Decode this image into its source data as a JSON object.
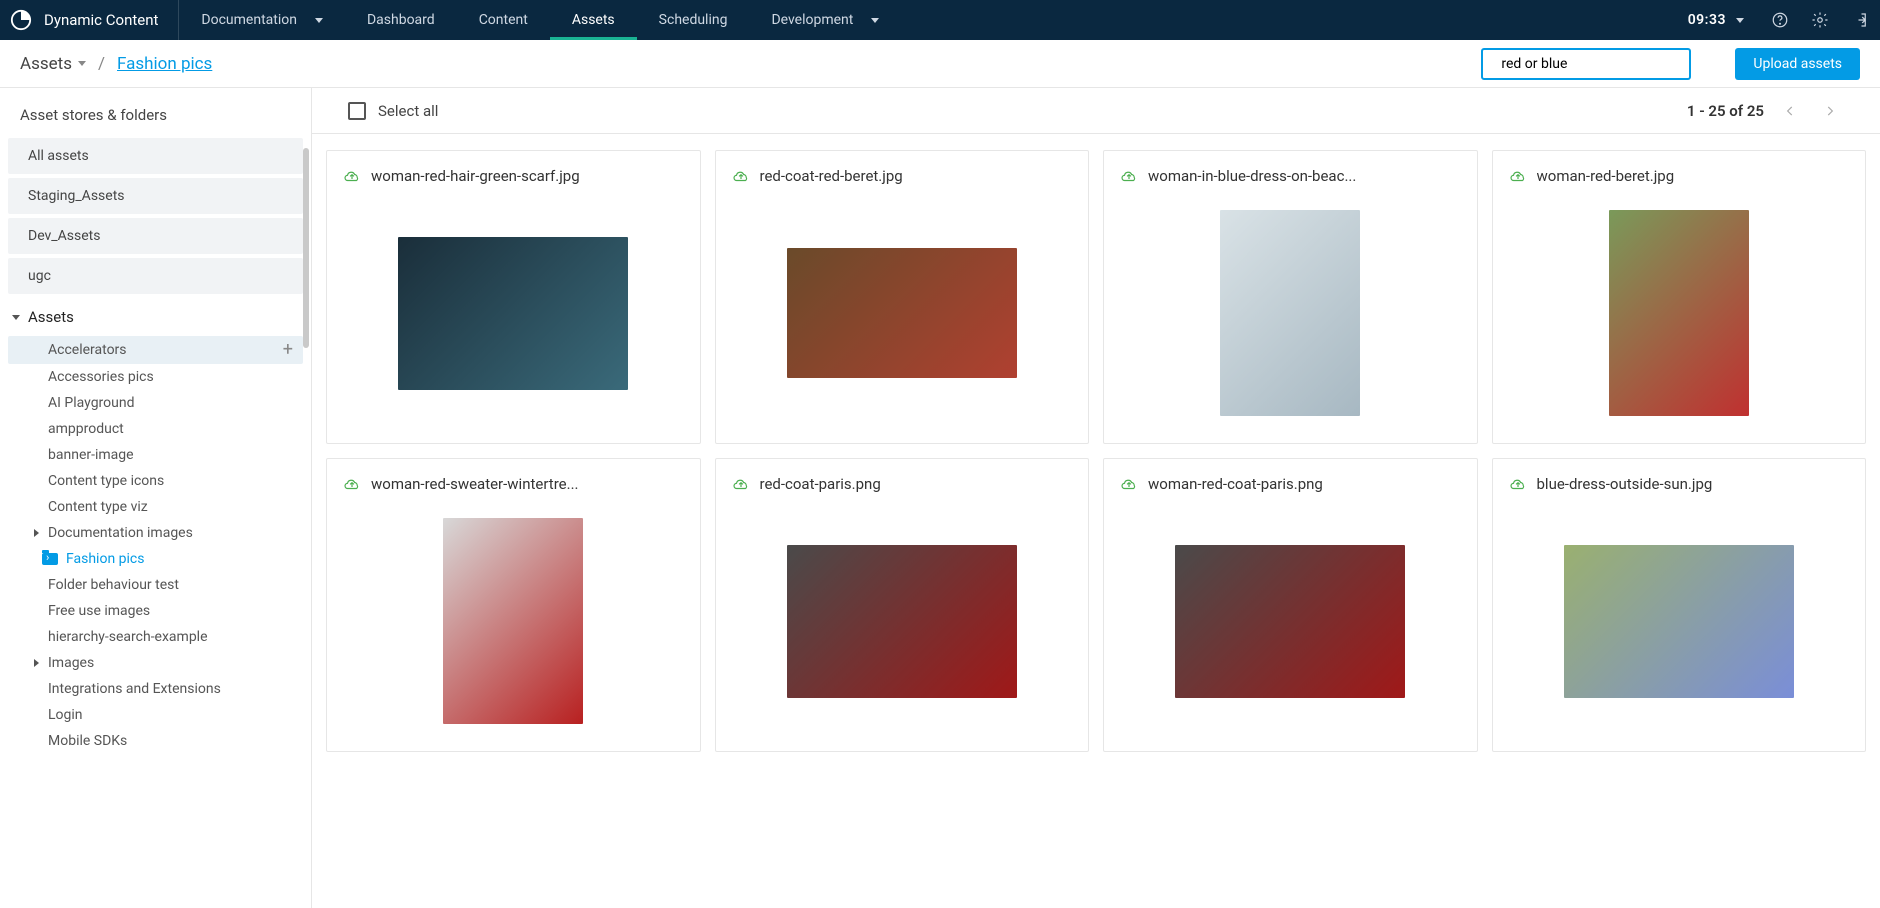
{
  "header": {
    "brand": "Dynamic Content",
    "nav": [
      {
        "label": "Documentation",
        "caret": true
      },
      {
        "label": "Dashboard"
      },
      {
        "label": "Content"
      },
      {
        "label": "Assets",
        "active": true
      },
      {
        "label": "Scheduling"
      },
      {
        "label": "Development",
        "caret": true
      }
    ],
    "time": "09:33"
  },
  "subbar": {
    "root": "Assets",
    "current": "Fashion pics",
    "search_value": "red or blue",
    "upload_label": "Upload assets"
  },
  "sidebar": {
    "heading": "Asset stores & folders",
    "stores": [
      "All assets",
      "Staging_Assets",
      "Dev_Assets",
      "ugc"
    ],
    "assets_root": "Assets",
    "tree": [
      {
        "label": "Accelerators",
        "selected": true,
        "add": true
      },
      {
        "label": "Accessories pics"
      },
      {
        "label": "AI Playground"
      },
      {
        "label": "ampproduct"
      },
      {
        "label": "banner-image"
      },
      {
        "label": "Content type icons"
      },
      {
        "label": "Content type viz"
      },
      {
        "label": "Documentation images",
        "caret": true
      },
      {
        "label": "Fashion pics",
        "highlight": true,
        "icon": true
      },
      {
        "label": "Folder behaviour test"
      },
      {
        "label": "Free use images"
      },
      {
        "label": "hierarchy-search-example"
      },
      {
        "label": "Images",
        "caret": true
      },
      {
        "label": "Integrations and Extensions"
      },
      {
        "label": "Login"
      },
      {
        "label": "Mobile SDKs"
      }
    ]
  },
  "toolbar": {
    "select_all": "Select all",
    "paging": "1 - 25 of 25"
  },
  "assets": [
    {
      "name": "woman-red-hair-green-scarf.jpg",
      "shape": "landscape",
      "g": [
        "#1a2e3a",
        "#3a6a7a"
      ]
    },
    {
      "name": "red-coat-red-beret.jpg",
      "shape": "landscape2",
      "g": [
        "#6a4a2a",
        "#b04030"
      ]
    },
    {
      "name": "woman-in-blue-dress-on-beac...",
      "shape": "portrait",
      "g": [
        "#d9e2e6",
        "#a7b8c2"
      ]
    },
    {
      "name": "woman-red-beret.jpg",
      "shape": "portrait",
      "g": [
        "#7a9a5a",
        "#c03030"
      ]
    },
    {
      "name": "woman-red-sweater-wintertre...",
      "shape": "portrait2",
      "g": [
        "#d8d8d8",
        "#b82020"
      ]
    },
    {
      "name": "red-coat-paris.png",
      "shape": "landscape",
      "g": [
        "#4a4a4a",
        "#a01818"
      ]
    },
    {
      "name": "woman-red-coat-paris.png",
      "shape": "landscape",
      "g": [
        "#4a4a4a",
        "#a01818"
      ]
    },
    {
      "name": "blue-dress-outside-sun.jpg",
      "shape": "landscape",
      "g": [
        "#9ab070",
        "#7a8ed8"
      ]
    }
  ]
}
